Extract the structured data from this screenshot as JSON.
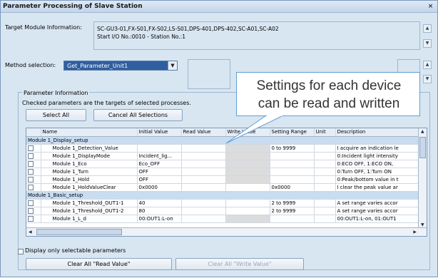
{
  "window": {
    "title": "Parameter Processing of Slave Station",
    "close_glyph": "×"
  },
  "target": {
    "label": "Target Module Information:",
    "line1": "SC-GU3-01,FX-S01,FX-S02,LS-S01,DPS-401,DPS-402,SC-A01,SC-A02",
    "line2": "Start I/O No.:0010 - Station No.:1"
  },
  "method": {
    "label": "Method selection:",
    "value": "Get_Parameter_Unit1"
  },
  "callout": {
    "line1": "Settings for each device",
    "line2": "can be read and written"
  },
  "param_info": {
    "title": "Parameter Information",
    "hint": "Checked parameters are the targets of selected processes.",
    "select_all": "Select All",
    "cancel_all": "Cancel All Selections"
  },
  "grid": {
    "columns": [
      "Name",
      "Initial Value",
      "Read Value",
      "Write Value",
      "Setting Range",
      "Unit",
      "Description"
    ],
    "rows": [
      {
        "type": "group",
        "name": "Module 1_Display_setup"
      },
      {
        "type": "item",
        "name": "Module 1_Detection_Value",
        "initial": "",
        "range": "0 to 9999",
        "unit": "",
        "desc": "I acquire an indication le"
      },
      {
        "type": "item",
        "name": "Module 1_DisplayMode",
        "initial": "Incident_lig...",
        "range": "",
        "unit": "",
        "desc": "0:Incident light intensity"
      },
      {
        "type": "item",
        "name": "Module 1_Eco",
        "initial": "Eco_OFF",
        "range": "",
        "unit": "",
        "desc": "0:ECO OFF, 1:ECO ON,"
      },
      {
        "type": "item",
        "name": "Module 1_Turn",
        "initial": "OFF",
        "range": "",
        "unit": "",
        "desc": "0:Turn OFF, 1:Turn ON"
      },
      {
        "type": "item",
        "name": "Module 1_Hold",
        "initial": "OFF",
        "range": "",
        "unit": "",
        "desc": "0:Peak/bottom value in t"
      },
      {
        "type": "item",
        "name": "Module 1_HoldValueClear",
        "initial": "0x0000",
        "range": "0x0000",
        "unit": "",
        "desc": "I clear the peak value ar"
      },
      {
        "type": "group",
        "name": "Module 1_Basic_setup"
      },
      {
        "type": "item",
        "name": "Module 1_Threshold_OUT1-1",
        "initial": "40",
        "range": "2 to 9999",
        "unit": "",
        "desc": "A set range varies accor"
      },
      {
        "type": "item",
        "name": "Module 1_Threshold_OUT1-2",
        "initial": "80",
        "range": "2 to 9999",
        "unit": "",
        "desc": "A set range varies accor"
      },
      {
        "type": "item",
        "name": "Module 1_L_d",
        "initial": "00:OUT1:L-on",
        "range": "",
        "unit": "",
        "desc": "00:OUT1:L-on, 01:OUT1"
      }
    ]
  },
  "footer": {
    "only_selectable": "Display only selectable parameters",
    "clear_read": "Clear All \"Read Value\"",
    "clear_write": "Clear All \"Write Value\""
  }
}
